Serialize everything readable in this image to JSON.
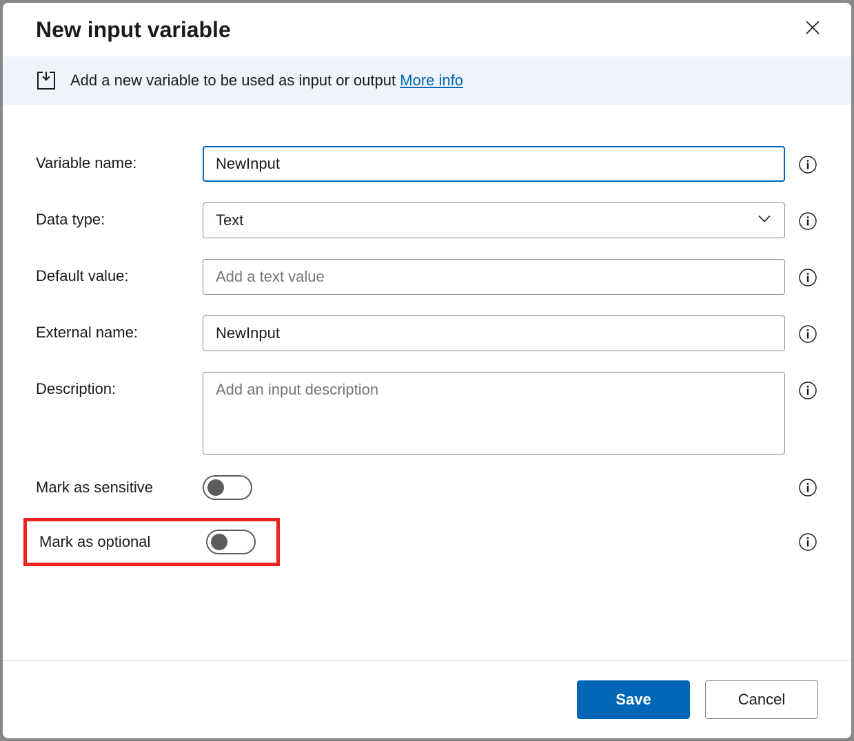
{
  "dialog": {
    "title": "New input variable"
  },
  "banner": {
    "text": "Add a new variable to be used as input or output ",
    "link_text": "More info"
  },
  "form": {
    "variable_name": {
      "label": "Variable name:",
      "value": "NewInput"
    },
    "data_type": {
      "label": "Data type:",
      "value": "Text"
    },
    "default_value": {
      "label": "Default value:",
      "placeholder": "Add a text value",
      "value": ""
    },
    "external_name": {
      "label": "External name:",
      "value": "NewInput"
    },
    "description": {
      "label": "Description:",
      "placeholder": "Add an input description",
      "value": ""
    },
    "mark_sensitive": {
      "label": "Mark as sensitive",
      "checked": false
    },
    "mark_optional": {
      "label": "Mark as optional",
      "checked": false
    }
  },
  "footer": {
    "save": "Save",
    "cancel": "Cancel"
  }
}
